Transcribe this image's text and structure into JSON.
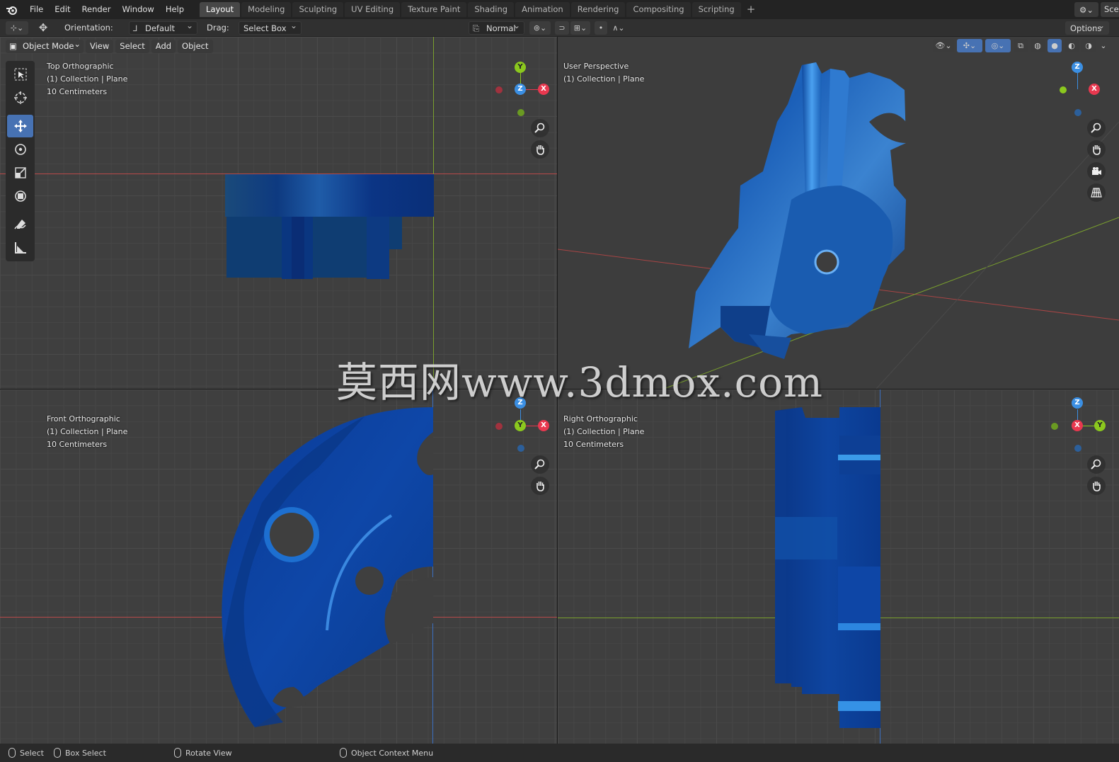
{
  "menu": {
    "file": "File",
    "edit": "Edit",
    "render": "Render",
    "window": "Window",
    "help": "Help"
  },
  "workspace_tabs": [
    "Layout",
    "Modeling",
    "Sculpting",
    "UV Editing",
    "Texture Paint",
    "Shading",
    "Animation",
    "Rendering",
    "Compositing",
    "Scripting"
  ],
  "workspace_add": "+",
  "scene_label": "Sce",
  "tool_header": {
    "orientation_label": "Orientation:",
    "orientation_value": "Default",
    "drag_label": "Drag:",
    "drag_value": "Select Box",
    "transform_space": "Normal",
    "options_label": "Options"
  },
  "view_header": {
    "mode": "Object Mode",
    "view": "View",
    "select": "Select",
    "add": "Add",
    "object": "Object"
  },
  "viewports": {
    "top": {
      "title": "Top Orthographic",
      "collection": "(1) Collection | Plane",
      "scale": "10 Centimeters",
      "axes": [
        "Y",
        "Z",
        "X"
      ]
    },
    "persp": {
      "title": "User Perspective",
      "collection": "(1) Collection | Plane",
      "axes": [
        "Z",
        "X"
      ]
    },
    "front": {
      "title": "Front Orthographic",
      "collection": "(1) Collection | Plane",
      "scale": "10 Centimeters",
      "axes": [
        "Z",
        "Y",
        "X"
      ]
    },
    "right": {
      "title": "Right Orthographic",
      "collection": "(1) Collection | Plane",
      "scale": "10 Centimeters",
      "axes": [
        "Z",
        "X",
        "Y"
      ]
    }
  },
  "watermark": "莫西网www.3dmox.com",
  "status": {
    "select": "Select",
    "box_select": "Box Select",
    "rotate_view": "Rotate View",
    "context_menu": "Object Context Menu"
  },
  "colors": {
    "accent": "#4772b3",
    "axis_x": "#e8384f",
    "axis_y": "#8bc81e",
    "axis_z": "#3b8fe3",
    "model_blue": "#0e3f8a"
  }
}
